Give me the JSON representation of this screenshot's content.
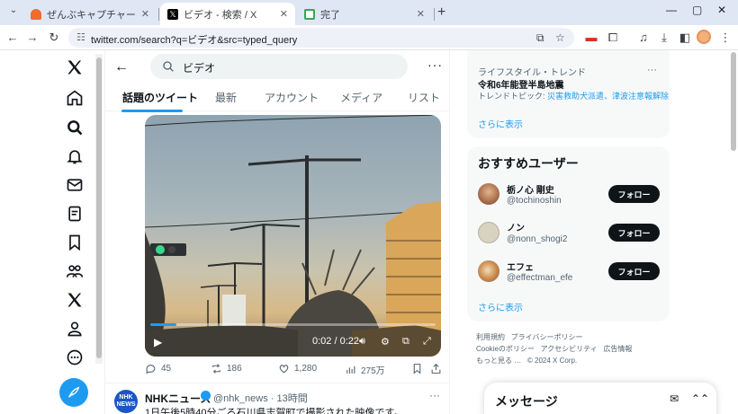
{
  "browser": {
    "tabs": [
      {
        "title": "ぜんぶキャプチャー",
        "active": false,
        "favicon_color": "#f26b2a"
      },
      {
        "title": "ビデオ - 検索 / X",
        "active": true,
        "favicon_color": "#000000"
      },
      {
        "title": "完了",
        "active": false,
        "favicon_color": "#34a853"
      }
    ],
    "url": "twitter.com/search?q=ビデオ&src=typed_query"
  },
  "x": {
    "search_query": "ビデオ",
    "tabs": [
      "話題のツイート",
      "最新",
      "アカウント",
      "メディア",
      "リスト"
    ],
    "active_tab": 0,
    "accent": "#1d9bf0",
    "video": {
      "time": "0:02 / 0:22",
      "progress": 0.09
    },
    "tweet_actions": {
      "replies": "45",
      "retweets": "186",
      "likes": "1,280",
      "views": "275万"
    },
    "tweet2": {
      "name": "NHKニュース",
      "handle_time": "@nhk_news · 13時間",
      "text": "1日午後5時40分ごろ石川県志賀町で撮影された映像です。",
      "avatar_text": "NHK NEWS"
    }
  },
  "sidebar": {
    "trend": {
      "category": "ライフスタイル・トレンド",
      "name": "令和6年能登半島地震",
      "topic_label": "トレンドトピック: ",
      "topic_links": "災害救助犬派遣、津波注意報解除"
    },
    "show_more": "さらに表示",
    "who_to_follow": {
      "title": "おすすめユーザー",
      "users": [
        {
          "name": "栃ノ心 剛史",
          "handle": "@tochinoshin",
          "button": "フォロー"
        },
        {
          "name": "ノン",
          "handle": "@nonn_shogi2",
          "button": "フォロー"
        },
        {
          "name": "エフェ",
          "handle": "@effectman_efe",
          "button": "フォロー"
        }
      ],
      "show_more": "さらに表示"
    },
    "footer": {
      "line1": [
        "利用規約",
        "プライバシーポリシー"
      ],
      "line2": [
        "Cookieのポリシー",
        "アクセシビリティ",
        "広告情報"
      ],
      "more": "もっと見る …",
      "copyright": "© 2024 X Corp."
    },
    "messages": "メッセージ"
  }
}
